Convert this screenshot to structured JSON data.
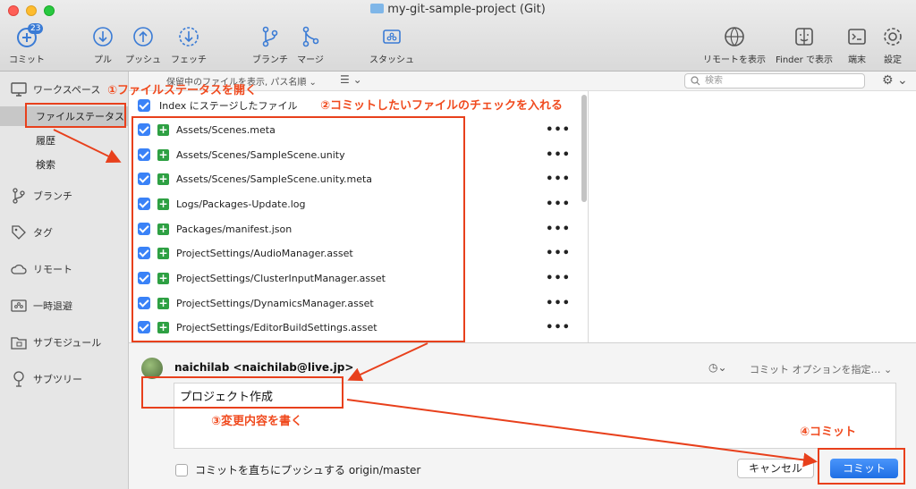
{
  "window": {
    "title": "my-git-sample-project (Git)"
  },
  "toolbar": {
    "commit": {
      "label": "コミット",
      "badge": "23"
    },
    "pull": "プル",
    "push": "プッシュ",
    "fetch": "フェッチ",
    "branch": "ブランチ",
    "merge": "マージ",
    "stash": "スタッシュ",
    "show_remote": "リモートを表示",
    "show_finder": "Finder で表示",
    "terminal": "端末",
    "settings": "設定"
  },
  "sidebar": {
    "workspace": "ワークスペース",
    "file_status": "ファイルステータス",
    "history": "履歴",
    "search": "検索",
    "branches": "ブランチ",
    "tags": "タグ",
    "remotes": "リモート",
    "stashes": "一時退避",
    "submodules": "サブモジュール",
    "subtrees": "サブツリー"
  },
  "file_pane": {
    "sort_label": "保留中のファイルを表示, パス名順",
    "index_label": "Index にステージしたファイル",
    "files": [
      "Assets/Scenes.meta",
      "Assets/Scenes/SampleScene.unity",
      "Assets/Scenes/SampleScene.unity.meta",
      "Logs/Packages-Update.log",
      "Packages/manifest.json",
      "ProjectSettings/AudioManager.asset",
      "ProjectSettings/ClusterInputManager.asset",
      "ProjectSettings/DynamicsManager.asset",
      "ProjectSettings/EditorBuildSettings.asset"
    ],
    "more": "•••"
  },
  "right_pane": {
    "search_placeholder": "検索"
  },
  "commit": {
    "author": "naichilab <naichilab@live.jp>",
    "options": "コミット オプションを指定…",
    "message": "プロジェクト作成",
    "push_label": "コミットを直ちにプッシュする origin/master",
    "cancel": "キャンセル",
    "submit": "コミット"
  },
  "annotations": {
    "step1": "①ファイルステータスを開く",
    "step2": "②コミットしたいファイルのチェックを入れる",
    "step3": "③変更内容を書く",
    "step4": "④コミット"
  },
  "colors": {
    "accent": "#3a82f7",
    "annotation": "#f04a1e",
    "added": "#2ea043"
  }
}
